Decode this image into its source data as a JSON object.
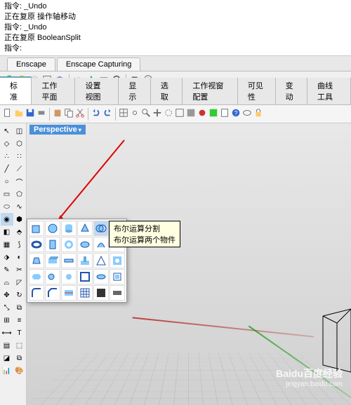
{
  "command": {
    "line1": "指令: _Undo",
    "line2": "正在复原 操作轴移动",
    "line3": "指令: _Undo",
    "line4": "正在复原 BooleanSplit",
    "line5": "指令:"
  },
  "plugin_tabs": {
    "enscape": "Enscape",
    "capturing": "Enscape Capturing"
  },
  "main_tabs": {
    "std": "标准",
    "workplane": "工作平面",
    "viewsetup": "设置视图",
    "display": "显示",
    "select": "选取",
    "viewportcfg": "工作视窗配置",
    "visibility": "可见性",
    "transform": "变动",
    "curvetools": "曲线工具"
  },
  "viewport": {
    "label": "Perspective"
  },
  "tooltip": {
    "line1": "布尔运算分割",
    "line2": "布尔运算两个物件"
  },
  "icons": {
    "new": "new-doc",
    "open": "open",
    "save": "save",
    "print": "print",
    "cut": "cut",
    "copy": "copy",
    "paste": "paste",
    "undo": "undo",
    "redo": "redo"
  },
  "colors": {
    "accent": "#4a90d9",
    "tooltip_bg": "#ffffe1",
    "axis_x": "#aa0000",
    "axis_y": "#009600"
  },
  "watermark": {
    "brand": "Baidu百度经验",
    "url": "jingyan.baidu.com"
  }
}
